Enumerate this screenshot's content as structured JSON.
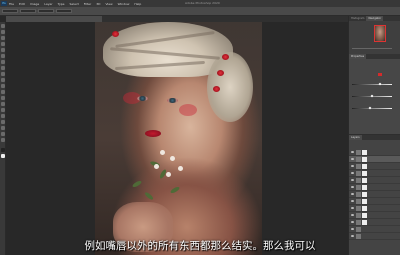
{
  "menubar": {
    "logo": "Ps",
    "items": [
      "Ps",
      "File",
      "Edit",
      "Image",
      "Layer",
      "Type",
      "Select",
      "Filter",
      "3D",
      "View",
      "Window",
      "Help"
    ],
    "title": "Adobe Photoshop 2020"
  },
  "subtitle": "例如嘴唇以外的所有东西都那么结实。那么我可以",
  "right_panel": {
    "tabs": [
      "Histogram",
      "Navigator"
    ],
    "properties_tab": "Properties",
    "layers_tab": "Layers"
  },
  "colors": {
    "menubar": "#383838",
    "panel": "#474747",
    "canvas_bg": "#282828",
    "accent_red": "#d42b2b"
  }
}
